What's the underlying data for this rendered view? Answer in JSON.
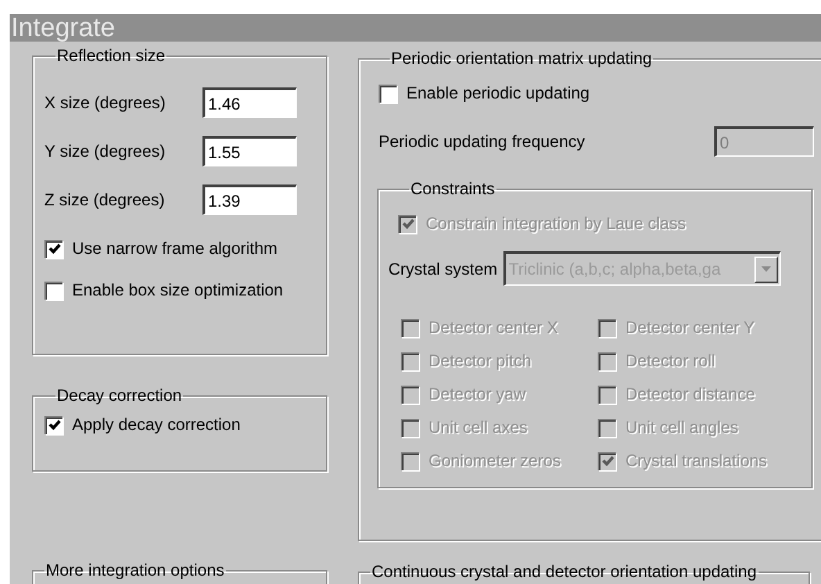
{
  "window": {
    "title": "Integrate"
  },
  "reflection_size": {
    "title": "Reflection size",
    "fields": [
      {
        "label": "X size (degrees)",
        "value": "1.46"
      },
      {
        "label": "Y size (degrees)",
        "value": "1.55"
      },
      {
        "label": "Z size (degrees)",
        "value": "1.39"
      }
    ],
    "options": [
      {
        "label": "Use narrow frame algorithm",
        "checked": true
      },
      {
        "label": "Enable box size optimization",
        "checked": false
      }
    ]
  },
  "decay_correction": {
    "title": "Decay correction",
    "options": [
      {
        "label": "Apply decay correction",
        "checked": true
      }
    ]
  },
  "more_integration_options": {
    "title": "More integration options"
  },
  "periodic_updating": {
    "title": "Periodic orientation matrix updating",
    "options": [
      {
        "label": "Enable periodic updating",
        "checked": false
      }
    ],
    "frequency": {
      "label": "Periodic updating frequency",
      "value": "0",
      "disabled": true
    },
    "constraints": {
      "title": "Constraints",
      "laue": {
        "label": "Constrain integration by Laue class",
        "checked": true,
        "disabled": true
      },
      "crystal_system": {
        "label": "Crystal system",
        "value": "Triclinic (a,b,c; alpha,beta,ga",
        "disabled": true
      },
      "parameters": [
        {
          "label": "Detector center X",
          "checked": false,
          "disabled": true
        },
        {
          "label": "Detector center Y",
          "checked": false,
          "disabled": true
        },
        {
          "label": "Detector pitch",
          "checked": false,
          "disabled": true
        },
        {
          "label": "Detector roll",
          "checked": false,
          "disabled": true
        },
        {
          "label": "Detector yaw",
          "checked": false,
          "disabled": true
        },
        {
          "label": "Detector distance",
          "checked": false,
          "disabled": true
        },
        {
          "label": "Unit cell axes",
          "checked": false,
          "disabled": true
        },
        {
          "label": "Unit cell angles",
          "checked": false,
          "disabled": true
        },
        {
          "label": "Goniometer zeros",
          "checked": false,
          "disabled": true
        },
        {
          "label": "Crystal translations",
          "checked": true,
          "disabled": true
        }
      ]
    }
  },
  "continuous_updating": {
    "title": "Continuous crystal and detector orientation updating"
  }
}
